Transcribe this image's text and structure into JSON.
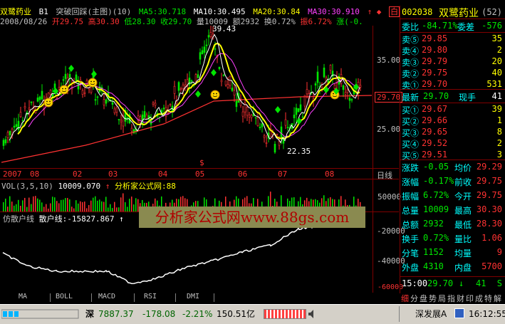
{
  "header": {
    "name": "双鹭药业",
    "b1": "B1",
    "indicator": "突破回踩(主图)(10)",
    "ma5": "MA5:30.718",
    "ma10": "MA10:30.495",
    "ma20": "MA20:30.84",
    "ma30": "MA30:30.910",
    "arrows": "↑ ◆",
    "bai": "白"
  },
  "info": {
    "date": "2008/08/26",
    "open": "开29.75",
    "high": "高30.30",
    "low": "低28.30",
    "close": "收29.70",
    "vol": "量10009",
    "amt": "额2932",
    "turn": "换0.72%",
    "amp": "振6.72%",
    "chg": "涨(-0."
  },
  "price_axis": {
    "p35": "35.00",
    "p25": "25.00",
    "current": "29.70"
  },
  "price_labels": {
    "peak": "39.43",
    "low": "22.35"
  },
  "time_axis": [
    "2007",
    "08",
    "02",
    "03",
    "04",
    "05",
    "06",
    "07",
    "08",
    "日线"
  ],
  "volume": {
    "label": "VOL(3,5,10)",
    "value": "10009.070",
    "arrow": "↑",
    "source": "分析家公式网:88",
    "axis": "50000",
    "axis2": "20000"
  },
  "sub": {
    "label": "仿散户线",
    "value": "散户线:-15827.867",
    "arrow": "↑",
    "axis1": "-20000",
    "axis2": "-40000",
    "axis3": "-60000"
  },
  "watermark": "分析家公式网www.88gs.com",
  "tabs": [
    "MA",
    "BOLL",
    "MACD",
    "RSI",
    "DMI"
  ],
  "quote": {
    "code": "002038",
    "name": "双鹭药业",
    "tag": "(52)",
    "wb_label": "委比",
    "wb": "-84.71%",
    "wc_label": "委差",
    "wc": "-576",
    "sells": [
      {
        "label": "卖⑤",
        "price": "29.85",
        "vol": "35"
      },
      {
        "label": "卖④",
        "price": "29.80",
        "vol": "2"
      },
      {
        "label": "卖③",
        "price": "29.79",
        "vol": "20"
      },
      {
        "label": "卖②",
        "price": "29.75",
        "vol": "40"
      },
      {
        "label": "卖①",
        "price": "29.70",
        "vol": "531"
      }
    ],
    "last_label": "最新",
    "last": "29.70",
    "now_label": "现手",
    "now": "41",
    "buys": [
      {
        "label": "买①",
        "price": "29.67",
        "vol": "39"
      },
      {
        "label": "买②",
        "price": "29.66",
        "vol": "1"
      },
      {
        "label": "买③",
        "price": "29.65",
        "vol": "8"
      },
      {
        "label": "买④",
        "price": "29.52",
        "vol": "2"
      },
      {
        "label": "买⑤",
        "price": "29.51",
        "vol": "3"
      }
    ],
    "stats": [
      {
        "l1": "涨跌",
        "v1": "-0.05",
        "l2": "均价",
        "v2": "29.29"
      },
      {
        "l1": "涨幅",
        "v1": "-0.17%",
        "l2": "前收",
        "v2": "29.75"
      },
      {
        "l1": "振幅",
        "v1": "6.72%",
        "l2": "今开",
        "v2": "29.75"
      },
      {
        "l1": "总量",
        "v1": "10009",
        "l2": "最高",
        "v2": "30.30"
      },
      {
        "l1": "总额",
        "v1": "2932",
        "l2": "最低",
        "v2": "28.30"
      },
      {
        "l1": "换手",
        "v1": "0.72%",
        "l2": "量比",
        "v2": "1.06"
      },
      {
        "l1": "分笔",
        "v1": "1152",
        "l2": "均量",
        "v2": "9"
      },
      {
        "l1": "外盘",
        "v1": "4310",
        "l2": "内盘",
        "v2": "5700"
      }
    ],
    "tick_time": "15:00",
    "tick_price": "29.70",
    "tick_arrow": "↓",
    "tick_vol": "41",
    "tick_flag": "S"
  },
  "bottom_menu": [
    "细",
    "分",
    "盘",
    "势",
    "局",
    "指",
    "财",
    "印",
    "成",
    "特",
    "解"
  ],
  "status": {
    "market": "深",
    "index": "7887.37",
    "chg": "-178.08",
    "pct": "-2.21%",
    "amount": "150.51亿",
    "release": "深发展A",
    "time": "16:12:55"
  },
  "colors": {
    "up": "#ff3232",
    "down": "#00e600",
    "ma5": "#ffffff",
    "ma10": "#ffff00",
    "ma20": "#ff40ff",
    "trend": "#ff3232",
    "frame": "#800000"
  }
}
